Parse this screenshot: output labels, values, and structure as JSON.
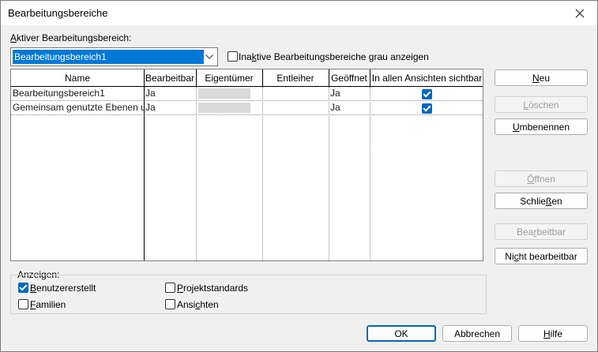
{
  "window": {
    "title": "Bearbeitungsbereiche"
  },
  "active": {
    "label_prefix": "",
    "label_u": "A",
    "label_rest": "ktiver Bearbeitungsbereich:",
    "value": "Bearbeitungsbereich1"
  },
  "inactive_gray": {
    "label_a": "Ina",
    "label_u": "k",
    "label_b": "tive Bearbeitungsbereiche grau anzeigen",
    "checked": false
  },
  "table": {
    "columns": [
      "Name",
      "Bearbeitbar",
      "Eigentümer",
      "Entleiher",
      "Geöffnet",
      "In allen Ansichten sichtbar"
    ],
    "rows": [
      {
        "name": "Bearbeitungsbereich1",
        "editable": "Ja",
        "owner": "",
        "borrower": "",
        "opened": "Ja",
        "visible_all": true
      },
      {
        "name": "Gemeinsam genutzte Ebenen und Raster",
        "editable": "Ja",
        "owner": "",
        "borrower": "",
        "opened": "Ja",
        "visible_all": true
      }
    ]
  },
  "buttons": {
    "neu": {
      "pre": "",
      "u": "N",
      "post": "eu",
      "enabled": true
    },
    "loeschen": {
      "pre": "",
      "u": "L",
      "post": "öschen",
      "enabled": false
    },
    "umbenennen": {
      "pre": "",
      "u": "U",
      "post": "mbenennen",
      "enabled": true
    },
    "oeffnen": {
      "pre": "",
      "u": "Ö",
      "post": "ffnen",
      "enabled": false
    },
    "schliessen": {
      "pre": "Schlie",
      "u": "ß",
      "post": "en",
      "enabled": true
    },
    "bearbeitbar": {
      "pre": "Bea",
      "u": "r",
      "post": "beitbar",
      "enabled": false
    },
    "nicht_bearbeitbar": {
      "pre": "Ni",
      "u": "c",
      "post": "ht bearbeitbar",
      "enabled": true
    }
  },
  "show": {
    "legend": "Anzeigen:",
    "benutzer": {
      "pre": "",
      "u": "B",
      "post": "enutzererstellt",
      "checked": true
    },
    "familien": {
      "pre": "",
      "u": "F",
      "post": "amilien",
      "checked": false
    },
    "projekt": {
      "pre": "",
      "u": "P",
      "post": "rojektstandards",
      "checked": false
    },
    "ansichten": {
      "pre": "Ansi",
      "u": "c",
      "post": "hten",
      "checked": false
    }
  },
  "footer": {
    "ok": "OK",
    "cancel": "Abbrechen",
    "help_pre": "",
    "help_u": "H",
    "help_post": "ilfe"
  }
}
